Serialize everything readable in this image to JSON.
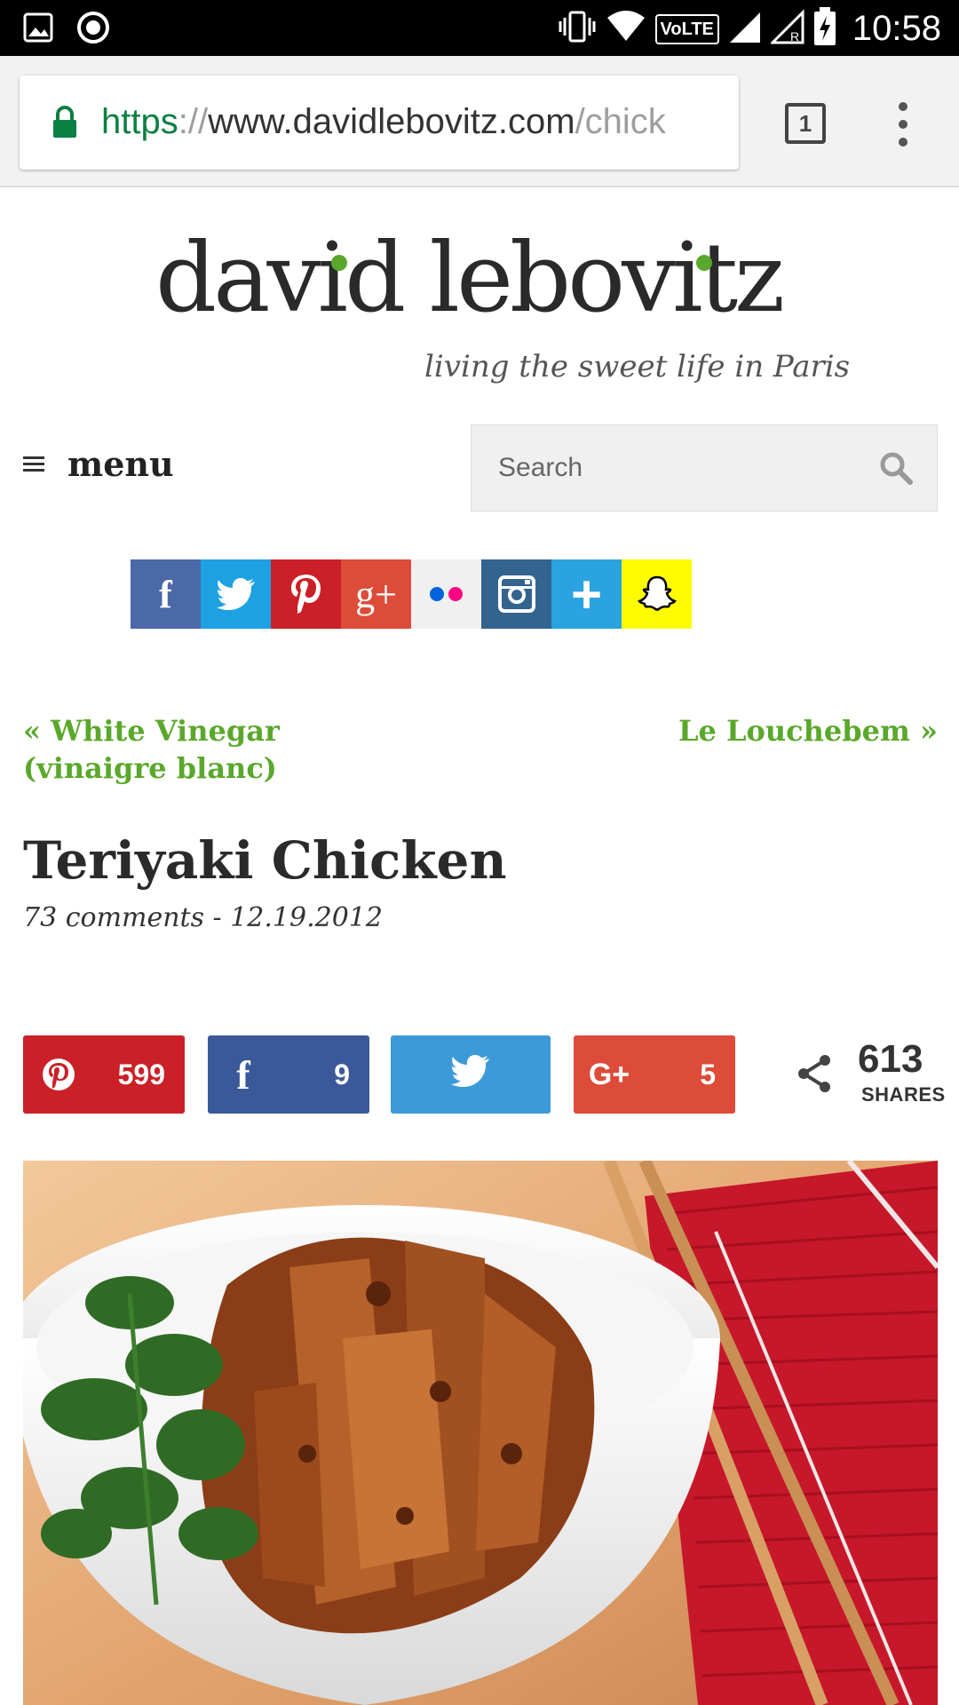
{
  "status_bar": {
    "time": "10:58",
    "icons": [
      "image-icon",
      "record-icon",
      "vibrate-icon",
      "wifi-icon",
      "volte-icon",
      "signal-icon",
      "signal-roaming-icon",
      "battery-charging-icon"
    ],
    "volte_label": "VoLTE"
  },
  "browser": {
    "url_scheme": "https",
    "url_sep": "://",
    "url_host": "www.davidlebovitz.com",
    "url_path": "/chick",
    "tab_count": "1"
  },
  "site": {
    "logo_title": "david lebovitz",
    "tagline": "living the sweet life in Paris",
    "menu_label": "menu",
    "search_placeholder": "Search",
    "accent_color": "#5aa82b"
  },
  "social_links": [
    {
      "name": "facebook",
      "glyph": "f",
      "color": "#4b68a7"
    },
    {
      "name": "twitter",
      "glyph": "",
      "color": "#1da1e2"
    },
    {
      "name": "pinterest",
      "glyph": "P",
      "color": "#cb2027"
    },
    {
      "name": "google-plus",
      "glyph": "g+",
      "color": "#dd4b39"
    },
    {
      "name": "flickr",
      "glyph": "",
      "color": "#f0f0f0"
    },
    {
      "name": "instagram",
      "glyph": "",
      "color": "#33638f"
    },
    {
      "name": "add",
      "glyph": "+",
      "color": "#2aa3e0"
    },
    {
      "name": "snapchat",
      "glyph": "",
      "color": "#fffc00"
    }
  ],
  "nav": {
    "prev": "« White Vinegar (vinaigre blanc)",
    "next": "Le Louchebem »"
  },
  "post": {
    "title": "Teriyaki Chicken",
    "meta": "73 comments - 12.19.2012"
  },
  "share": {
    "pinterest_count": "599",
    "facebook_count": "9",
    "google_count": "5",
    "total": "613",
    "total_label": "SHARES",
    "pinterest_color": "#cb2027",
    "facebook_color": "#3b5998",
    "twitter_color": "#3d9ad9",
    "google_color": "#dd4b39"
  }
}
